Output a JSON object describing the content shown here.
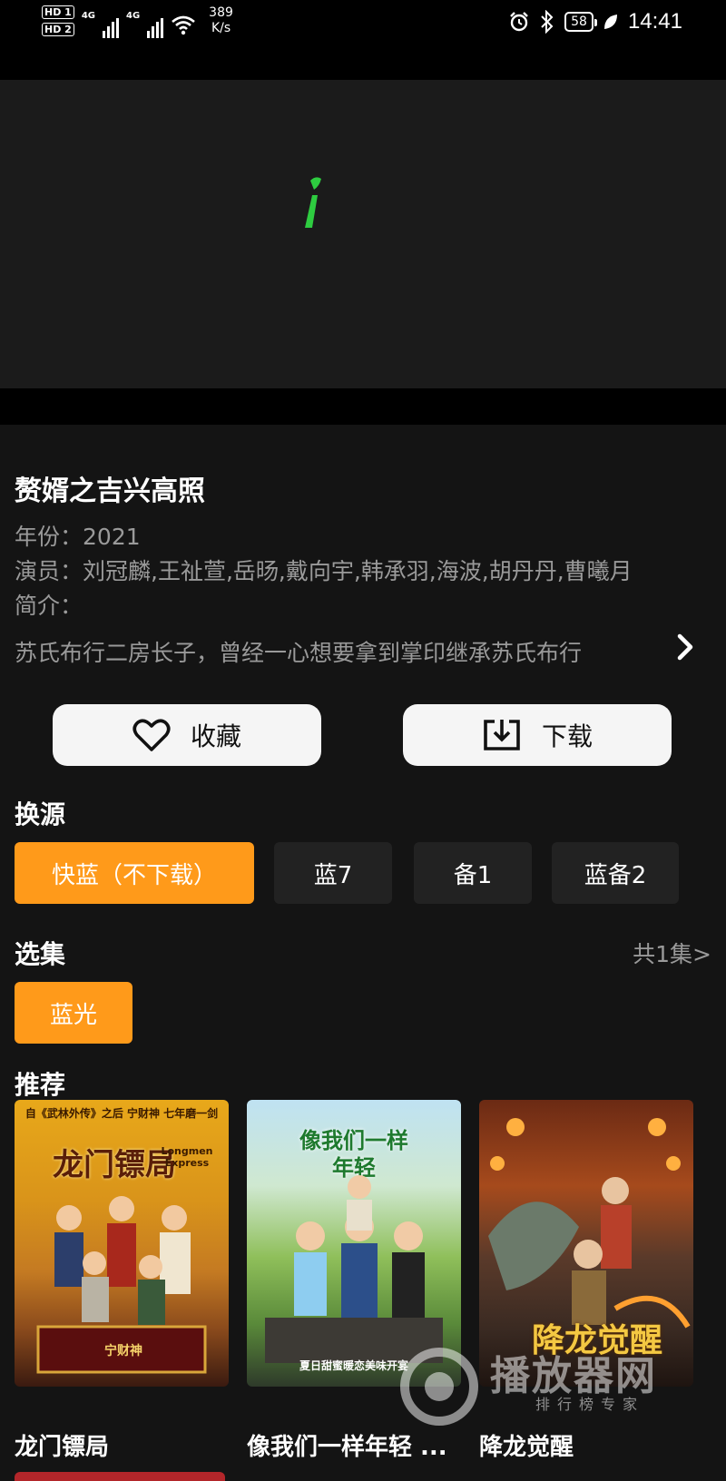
{
  "status_bar": {
    "sim1": "HD 1",
    "sim2": "HD 2",
    "net1": "4G",
    "net2": "4G",
    "speed_value": "389",
    "speed_unit": "K/s",
    "battery": "58",
    "time": "14:41",
    "icons": [
      "alarm-icon",
      "bluetooth-icon",
      "battery-icon",
      "leaf-icon",
      "wifi-icon",
      "signal-icon"
    ]
  },
  "player": {
    "loader_icon": "loading-spinner-icon",
    "loader_color": "#2ecc40"
  },
  "detail": {
    "title": "赘婿之吉兴高照",
    "year_label": "年份：",
    "year": "2021",
    "cast_label": "演员：",
    "cast": "刘冠麟,王祉萱,岳旸,戴向宇,韩承羽,海波,胡丹丹,曹曦月",
    "intro_label": "简介：",
    "synopsis": "苏氏布行二房长子，曾经一心想要拿到掌印继承苏氏布行"
  },
  "actions": {
    "favorite_label": "收藏",
    "download_label": "下载"
  },
  "sources": {
    "title": "换源",
    "items": [
      {
        "label": "快蓝（不下载）",
        "active": true
      },
      {
        "label": "蓝7",
        "active": false
      },
      {
        "label": "备1",
        "active": false
      },
      {
        "label": "蓝备2",
        "active": false
      }
    ]
  },
  "episodes": {
    "title": "选集",
    "count_label": "共1集>",
    "items": [
      {
        "label": "蓝光",
        "active": true
      }
    ]
  },
  "recommend": {
    "title": "推荐",
    "items": [
      {
        "title": "龙门镖局",
        "poster_text": "龙门镖局",
        "poster_subtext": "Longmen Express",
        "poster_top": "自《武林外传》之后 宁财神 七年磨一剑",
        "poster_credit": "宁财神"
      },
      {
        "title": "像我们一样年轻 ...",
        "poster_text": "像我们一样年轻",
        "poster_bottom": "夏日甜蜜暖恋美味开宴"
      },
      {
        "title": "降龙觉醒",
        "poster_text": "降龙觉醒"
      }
    ]
  },
  "watermark": {
    "text": "播放器网",
    "sub": "排行榜专家"
  },
  "colors": {
    "accent": "#ff9a1a",
    "background": "#141414",
    "chip": "#222222"
  }
}
